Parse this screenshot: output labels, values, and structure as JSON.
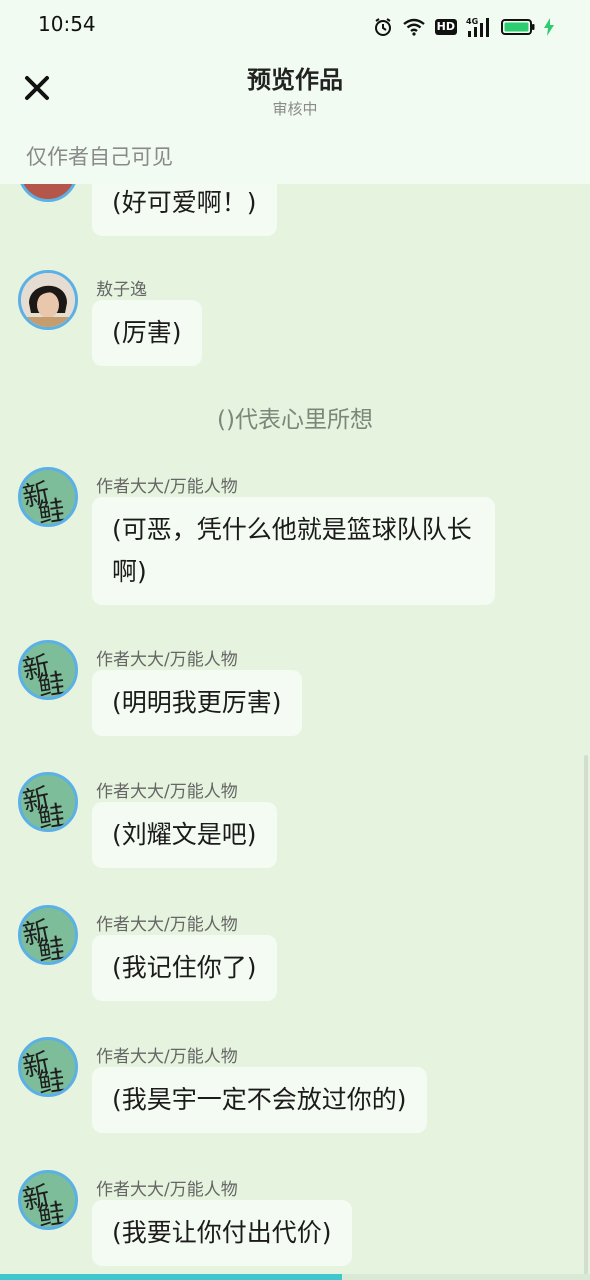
{
  "status_bar": {
    "time": "10:54",
    "icons": [
      "alarm-icon",
      "wifi-icon",
      "hd-icon",
      "signal-4g-icon",
      "battery-icon",
      "charging-icon"
    ],
    "hd_label": "HD",
    "network_label": "4G"
  },
  "header": {
    "title": "预览作品",
    "subtitle": "审核中",
    "close_icon": "close-icon"
  },
  "notice": "仅作者自己可见",
  "messages": [
    {
      "name": "",
      "text": "(好可爱啊！)",
      "avatar": "photo"
    },
    {
      "name": "敖子逸",
      "text": "(厉害)",
      "avatar": "photo"
    },
    {
      "name": "作者大大/万能人物",
      "text": "(可恶，凭什么他就是篮球队队长啊)",
      "avatar": "新鲑"
    },
    {
      "name": "作者大大/万能人物",
      "text": "(明明我更厉害)",
      "avatar": "新鲑"
    },
    {
      "name": "作者大大/万能人物",
      "text": "(刘耀文是吧)",
      "avatar": "新鲑"
    },
    {
      "name": "作者大大/万能人物",
      "text": "(我记住你了)",
      "avatar": "新鲑"
    },
    {
      "name": "作者大大/万能人物",
      "text": "(我昊宇一定不会放过你的)",
      "avatar": "新鲑"
    },
    {
      "name": "作者大大/万能人物",
      "text": "(我要让你付出代价)",
      "avatar": "新鲑"
    }
  ],
  "narration": "()代表心里所想",
  "avatar_text": {
    "c1": "新",
    "c2": "鲑"
  },
  "progress": 0.58,
  "colors": {
    "background": "#e6f3df",
    "header_bg": "#f1fbf1",
    "bubble_bg": "#f4fbf2",
    "avatar_border": "#5bb0e6",
    "progress": "#3fc7cf",
    "battery": "#2ecc71"
  }
}
